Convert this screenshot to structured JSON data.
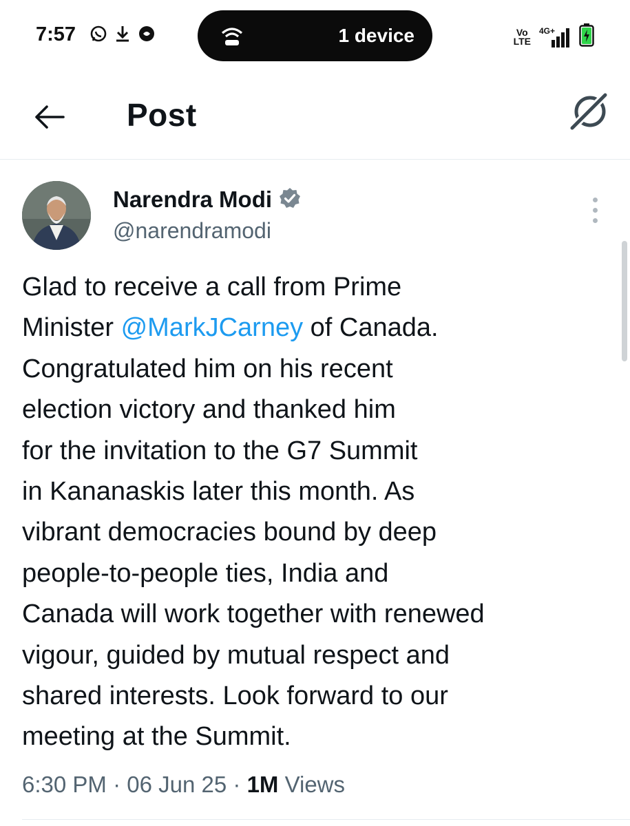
{
  "status_bar": {
    "time": "7:57",
    "left_icons": [
      "whatsapp-icon",
      "download-icon",
      "vpn-icon"
    ],
    "hotspot_label": "1 device",
    "volte": "Vo LTE",
    "network": "4G+",
    "battery": "charging"
  },
  "header": {
    "back_icon": "arrow-left-icon",
    "title": "Post",
    "grok_icon": "grok-icon"
  },
  "post": {
    "author_name": "Narendra Modi",
    "verified": true,
    "handle": "@narendramodi",
    "lines": [
      {
        "before": "Glad to receive a call from Prime",
        "mention": "",
        "after": ""
      },
      {
        "before": "Minister ",
        "mention": "@MarkJCarney",
        "after": " of Canada."
      },
      {
        "before": "Congratulated him on his recent",
        "mention": "",
        "after": ""
      },
      {
        "before": "election victory and thanked him",
        "mention": "",
        "after": ""
      },
      {
        "before": "for the invitation to the G7 Summit",
        "mention": "",
        "after": ""
      },
      {
        "before": "in Kananaskis later this month. As",
        "mention": "",
        "after": ""
      },
      {
        "before": "vibrant democracies bound by deep",
        "mention": "",
        "after": ""
      },
      {
        "before": "people-to-people ties, India and",
        "mention": "",
        "after": ""
      },
      {
        "before": "Canada will work together with renewed",
        "mention": "",
        "after": ""
      },
      {
        "before": "vigour, guided by mutual respect and",
        "mention": "",
        "after": ""
      },
      {
        "before": "shared interests. Look forward to our",
        "mention": "",
        "after": ""
      },
      {
        "before": "meeting at the Summit.",
        "mention": "",
        "after": ""
      }
    ],
    "time": "6:30 PM",
    "date": "06 Jun 25",
    "views_count": "1M",
    "views_label": "Views"
  },
  "colors": {
    "link": "#1d9bf0",
    "secondary_text": "#536471",
    "primary_text": "#0f1419"
  }
}
